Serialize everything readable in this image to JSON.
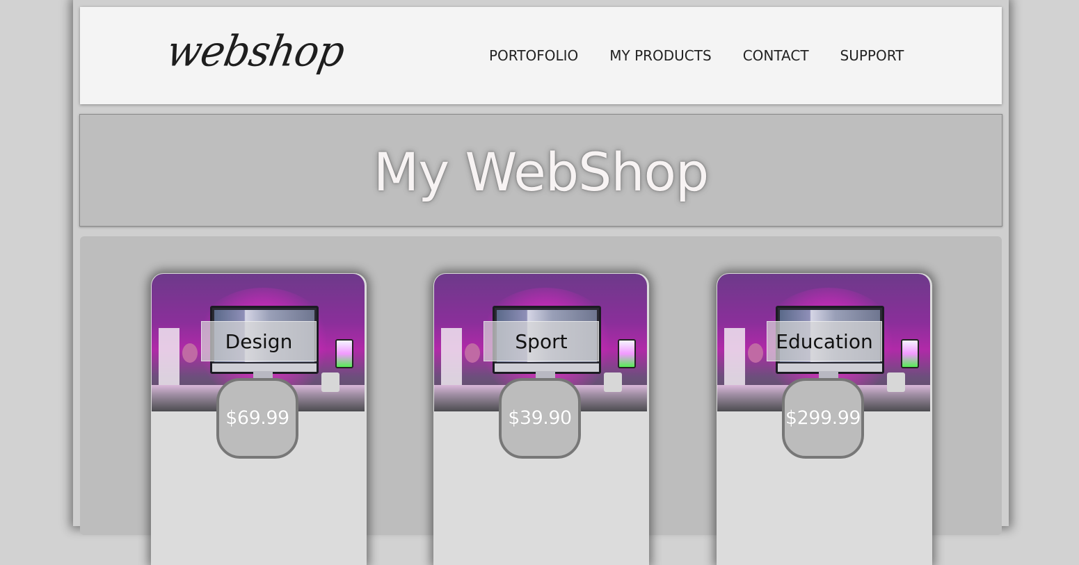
{
  "header": {
    "logo_text": "webshop",
    "nav": [
      {
        "label": "PORTOFOLIO"
      },
      {
        "label": "MY PRODUCTS"
      },
      {
        "label": "CONTACT"
      },
      {
        "label": "SUPPORT"
      }
    ]
  },
  "hero": {
    "title": "My WebShop"
  },
  "products": [
    {
      "category": "Design",
      "price": "$69.99"
    },
    {
      "category": "Sport",
      "price": "$39.90"
    },
    {
      "category": "Education",
      "price": "$299.99"
    }
  ],
  "colors": {
    "background": "#d2d2d2",
    "header_bg": "#f4f4f4",
    "hero_bg": "#bebebe",
    "card_bg": "#dcdcdc",
    "accent_glow": "#ff3cdc"
  }
}
